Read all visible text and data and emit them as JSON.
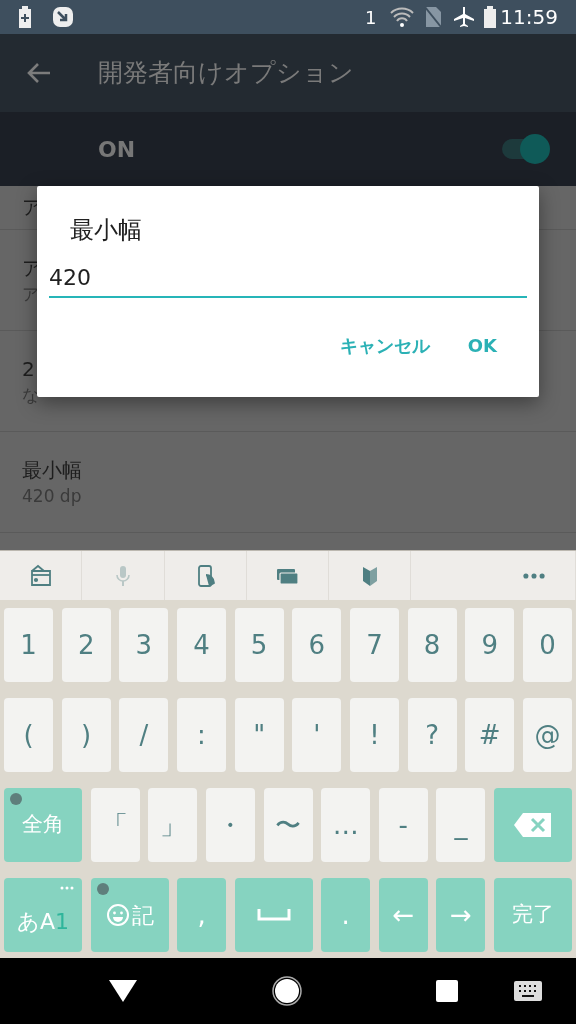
{
  "status_bar": {
    "sim_slot": "1",
    "time": "11:59"
  },
  "app_bar": {
    "title": "開発者向けオプション"
  },
  "master_switch": {
    "label": "ON",
    "on": true
  },
  "settings": [
    {
      "title": "ア"
    },
    {
      "title": "ア",
      "subtitle": "ア"
    },
    {
      "title": "2",
      "subtitle": "な"
    },
    {
      "title": "最小幅",
      "subtitle": "420 dp"
    }
  ],
  "dialog": {
    "title": "最小幅",
    "value": "420",
    "buttons": [
      "キャンセル",
      "OK"
    ]
  },
  "keyboard": {
    "toolbar": [
      {
        "disabled": false
      },
      {
        "disabled": true
      },
      {
        "disabled": false
      },
      {
        "disabled": false
      },
      {
        "disabled": false
      },
      {
        "disabled": false
      }
    ],
    "rows": [
      {
        "keys": [
          {
            "kind": "char",
            "label": "1"
          },
          {
            "kind": "char",
            "label": "2"
          },
          {
            "kind": "char",
            "label": "3"
          },
          {
            "kind": "char",
            "label": "4"
          },
          {
            "kind": "char",
            "label": "5"
          },
          {
            "kind": "char",
            "label": "6"
          },
          {
            "kind": "char",
            "label": "7"
          },
          {
            "kind": "char",
            "label": "8"
          },
          {
            "kind": "char",
            "label": "9"
          },
          {
            "kind": "char",
            "label": "0"
          }
        ]
      },
      {
        "keys": [
          {
            "kind": "char",
            "label": "("
          },
          {
            "kind": "char",
            "label": ")"
          },
          {
            "kind": "char",
            "label": "/"
          },
          {
            "kind": "char",
            "label": ":"
          },
          {
            "kind": "char",
            "label": "\""
          },
          {
            "kind": "char",
            "label": "'"
          },
          {
            "kind": "char",
            "label": "!"
          },
          {
            "kind": "char",
            "label": "?"
          },
          {
            "kind": "char",
            "label": "#"
          },
          {
            "kind": "char",
            "label": "@"
          }
        ]
      },
      {
        "keys": [
          {
            "kind": "wide",
            "label": "全角",
            "dot": true
          },
          {
            "kind": "char",
            "label": "「"
          },
          {
            "kind": "char",
            "label": "」"
          },
          {
            "kind": "char",
            "label": "・"
          },
          {
            "kind": "char",
            "label": "〜"
          },
          {
            "kind": "char",
            "label": "…"
          },
          {
            "kind": "char",
            "label": "-"
          },
          {
            "kind": "char",
            "label": "_"
          },
          {
            "kind": "delete"
          }
        ]
      },
      {
        "keys": [
          {
            "kind": "mode",
            "label": "あA",
            "accent": "1"
          },
          {
            "kind": "emoji",
            "label": "記",
            "dot": true
          },
          {
            "kind": "function",
            "label": ","
          },
          {
            "kind": "space"
          },
          {
            "kind": "function",
            "label": "."
          },
          {
            "kind": "function",
            "label": "←"
          },
          {
            "kind": "function",
            "label": "→"
          },
          {
            "kind": "wide",
            "label": "完了"
          }
        ]
      }
    ]
  }
}
